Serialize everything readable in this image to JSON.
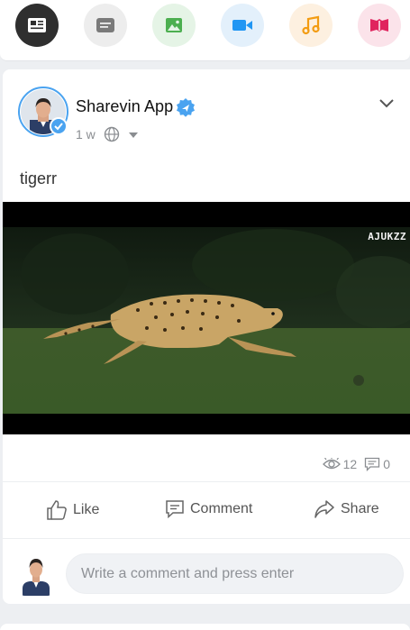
{
  "composer": {
    "types": [
      {
        "name": "article",
        "icon": "newspaper-icon",
        "bg": "#2f2f2f",
        "fg": "#ffffff",
        "active": true
      },
      {
        "name": "text",
        "icon": "message-square-icon",
        "bg": "#ededed",
        "fg": "#7a7a7a",
        "active": false
      },
      {
        "name": "photo",
        "icon": "image-icon",
        "bg": "#e5f4e6",
        "fg": "#4caf50",
        "active": false
      },
      {
        "name": "video",
        "icon": "video-camera-icon",
        "bg": "#e3f0fb",
        "fg": "#2196f3",
        "active": false
      },
      {
        "name": "audio",
        "icon": "music-note-icon",
        "bg": "#fdf0e0",
        "fg": "#f39c12",
        "active": false
      },
      {
        "name": "ebook",
        "icon": "book-open-icon",
        "bg": "#fbe3ea",
        "fg": "#e0245e",
        "active": false
      }
    ]
  },
  "post": {
    "author": "Sharevin App",
    "time": "1 w",
    "privacy_icon": "globe-icon",
    "text": "tigerr",
    "video": {
      "watermark": "AJUKZZ"
    },
    "stats": {
      "views": "12",
      "comments": "0"
    },
    "actions": {
      "like": "Like",
      "comment": "Comment",
      "share": "Share"
    },
    "comment_placeholder": "Write a comment and press enter"
  },
  "colors": {
    "accent": "#4aa3f0",
    "muted": "#8a8d91"
  }
}
